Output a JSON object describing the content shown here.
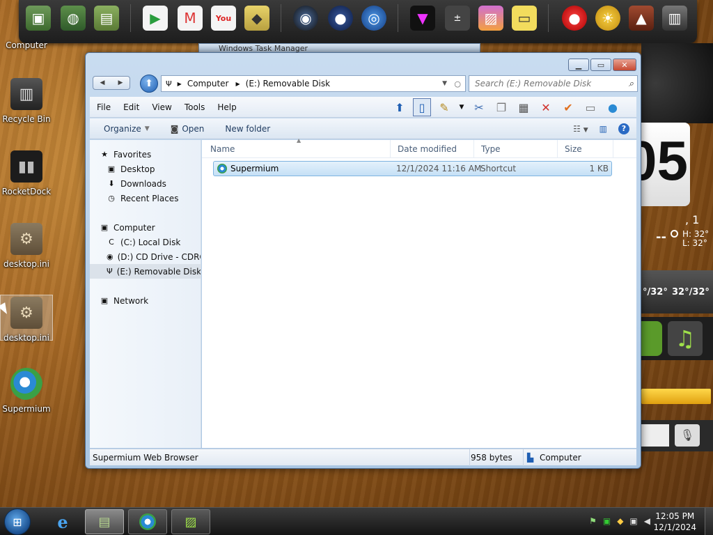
{
  "desktop": {
    "icons": [
      {
        "label": "Computer"
      },
      {
        "label": "Recycle Bin"
      },
      {
        "label": "RocketDock"
      },
      {
        "label": "desktop.ini"
      },
      {
        "label": "desktop.ini"
      },
      {
        "label": "Supermium"
      }
    ]
  },
  "background_window": {
    "title": "Windows Task Manager"
  },
  "widgets": {
    "clock_digits": "05",
    "date_fragment": ", 1",
    "weather_dash": "--",
    "high_label": "H:  32°",
    "low_label": "L:  32°",
    "forecast_1": "°/32°",
    "forecast_2": "32°/32°"
  },
  "explorer": {
    "address": {
      "crumbs": [
        "Computer",
        "(E:) Removable Disk"
      ]
    },
    "search": {
      "placeholder": "Search (E:) Removable Disk"
    },
    "menu": [
      "File",
      "Edit",
      "View",
      "Tools",
      "Help"
    ],
    "commands": {
      "organize": "Organize",
      "open": "Open",
      "new_folder": "New folder"
    },
    "nav": {
      "favorites": "Favorites",
      "desktop": "Desktop",
      "downloads": "Downloads",
      "recent": "Recent Places",
      "computer": "Computer",
      "drive_c": "(C:) Local Disk",
      "drive_d": "(D:) CD Drive - CDRO",
      "drive_e": "(E:) Removable Disk",
      "network": "Network"
    },
    "columns": {
      "name": "Name",
      "date": "Date modified",
      "type": "Type",
      "size": "Size"
    },
    "files": [
      {
        "name": "Supermium",
        "date": "12/1/2024 11:16 AM",
        "type": "Shortcut",
        "size": "1 KB"
      }
    ],
    "status": {
      "description": "Supermium Web Browser",
      "bytes": "958 bytes",
      "location": "Computer"
    }
  },
  "taskbar": {
    "time": "12:05 PM",
    "date": "12/1/2024"
  },
  "colors": {
    "accent": "#1f5fb3",
    "selection": "#c5e0f6"
  }
}
